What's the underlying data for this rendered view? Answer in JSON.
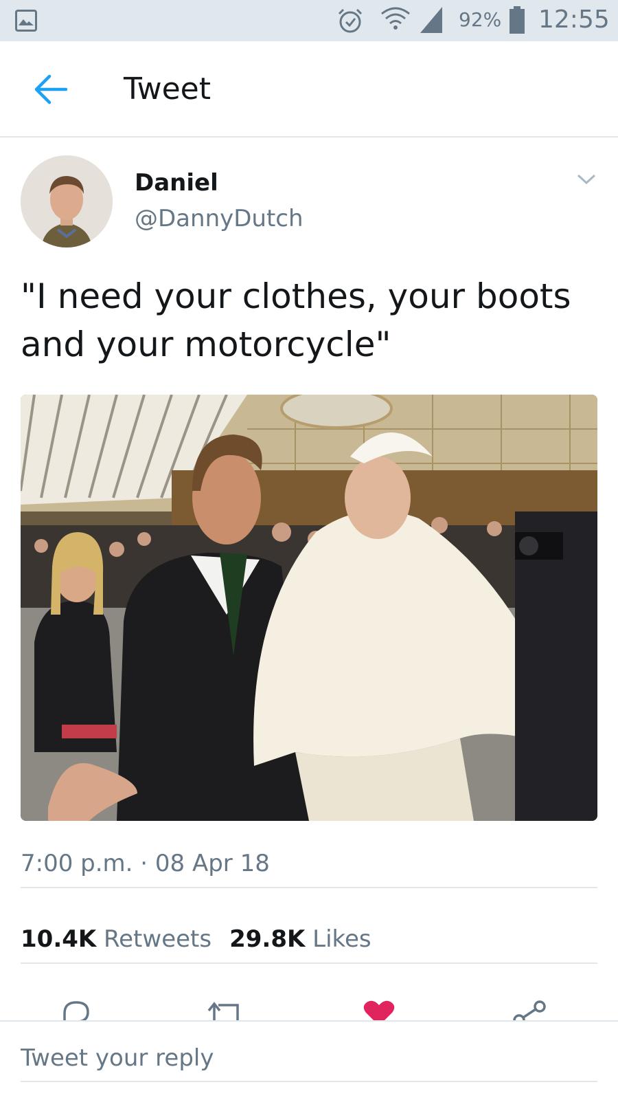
{
  "status_bar": {
    "battery_percent": "92%",
    "time": "12:55",
    "icons": [
      "gallery-icon",
      "alarm-icon",
      "wifi-icon",
      "signal-icon",
      "battery-icon"
    ]
  },
  "header": {
    "title": "Tweet",
    "back_icon": "arrow-left-icon"
  },
  "tweet": {
    "author_name": "Daniel",
    "author_handle": "@DannyDutch",
    "text": "\"I need your clothes, your boots and your motorcycle\"",
    "timestamp": "7:00 p.m. · 08 Apr 18",
    "retweets_count": "10.4K",
    "retweets_label": "Retweets",
    "likes_count": "29.8K",
    "likes_label": "Likes",
    "liked": true
  },
  "actions": [
    "reply-icon",
    "retweet-icon",
    "like-icon",
    "share-icon"
  ],
  "reply": {
    "placeholder": "Tweet your reply"
  },
  "colors": {
    "accent": "#1da1f2",
    "like": "#e0245e",
    "text": "#14171a",
    "secondary": "#657786",
    "status_bar_bg": "#e1e8ed"
  }
}
